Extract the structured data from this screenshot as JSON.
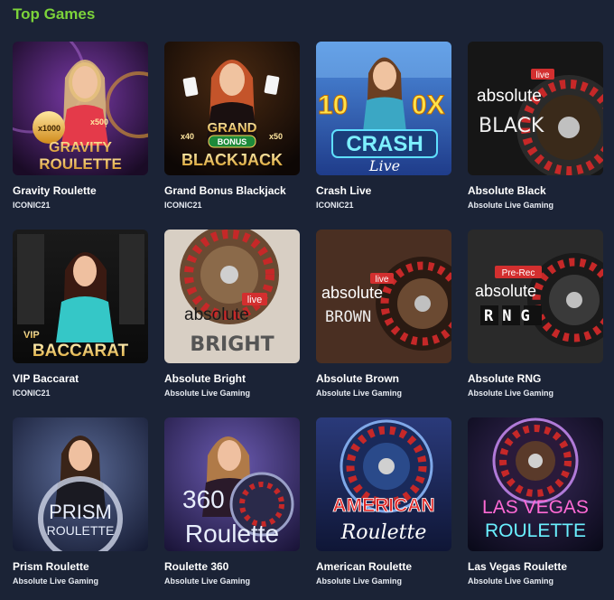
{
  "section": {
    "title": "Top Games"
  },
  "games": [
    {
      "name": "Gravity Roulette",
      "provider": "ICONIC21",
      "art": [
        "GRAVITY",
        "ROULETTE"
      ],
      "badges": [
        "x1000",
        "x500"
      ]
    },
    {
      "name": "Grand Bonus Blackjack",
      "provider": "ICONIC21",
      "art": [
        "GRAND",
        "BONUS",
        "BLACKJACK"
      ],
      "badges": [
        "x40",
        "x50"
      ]
    },
    {
      "name": "Crash Live",
      "provider": "ICONIC21",
      "art": [
        "10",
        "0X",
        "CRASH",
        "Live"
      ]
    },
    {
      "name": "Absolute Black",
      "provider": "Absolute Live Gaming",
      "art": [
        "live",
        "absolute",
        "BLACK"
      ]
    },
    {
      "name": "VIP Baccarat",
      "provider": "ICONIC21",
      "art": [
        "VIP",
        "BACCARAT"
      ]
    },
    {
      "name": "Absolute Bright",
      "provider": "Absolute Live Gaming",
      "art": [
        "live",
        "absolute",
        "BRIGHT"
      ]
    },
    {
      "name": "Absolute Brown",
      "provider": "Absolute Live Gaming",
      "art": [
        "live",
        "absolute",
        "BROWN"
      ]
    },
    {
      "name": "Absolute RNG",
      "provider": "Absolute Live Gaming",
      "art": [
        "Pre-Rec",
        "absolute",
        "RNG"
      ]
    },
    {
      "name": "Prism Roulette",
      "provider": "Absolute Live Gaming",
      "art": [
        "PRISM",
        "ROULETTE"
      ]
    },
    {
      "name": "Roulette 360",
      "provider": "Absolute Live Gaming",
      "art": [
        "360",
        "Roulette"
      ]
    },
    {
      "name": "American Roulette",
      "provider": "Absolute Live Gaming",
      "art": [
        "AMERICAN",
        "Roulette"
      ]
    },
    {
      "name": "Las Vegas Roulette",
      "provider": "Absolute Live Gaming",
      "art": [
        "LAS VEGAS",
        "ROULETTE"
      ]
    }
  ],
  "colors": {
    "accent": "#7cd33a",
    "background": "#1b2336",
    "text": "#ffffff"
  }
}
